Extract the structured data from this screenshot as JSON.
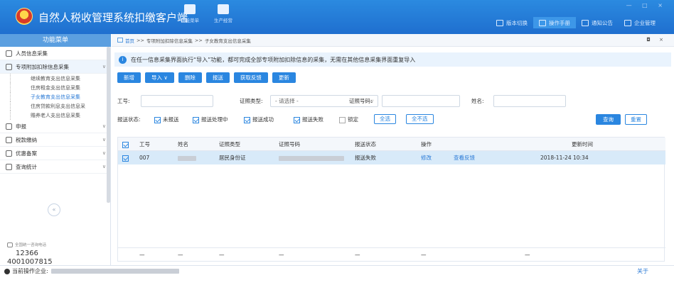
{
  "app": {
    "title": "自然人税收管理系统扣缴客户端",
    "window_controls": "— □ ×"
  },
  "topnav": [
    {
      "label": "功能菜单",
      "icon": "menu-icon"
    },
    {
      "label": "生产经营",
      "icon": "briefcase-icon"
    }
  ],
  "toplinks": [
    {
      "label": "版本切换",
      "icon": "version-icon",
      "active": false
    },
    {
      "label": "操作手册",
      "icon": "manual-icon",
      "active": true
    },
    {
      "label": "通知公告",
      "icon": "mail-icon",
      "active": false
    },
    {
      "label": "企业管理",
      "icon": "company-icon",
      "active": false
    }
  ],
  "sidebar": {
    "header": "功能菜单",
    "items": [
      {
        "label": "人员信息采集",
        "icon": "person-icon"
      },
      {
        "label": "专项附加扣除信息采集",
        "icon": "list-icon",
        "open": true
      }
    ],
    "sub_items": [
      {
        "label": "继续教育支出信息采集",
        "active": false
      },
      {
        "label": "住房租金支出信息采集",
        "active": false
      },
      {
        "label": "子女教育支出信息采集",
        "active": true
      },
      {
        "label": "住房贷款利息支出信息采",
        "active": false
      },
      {
        "label": "赡养老人支出信息采集",
        "active": false
      }
    ],
    "items_after": [
      {
        "label": "申报",
        "icon": "grid-icon"
      },
      {
        "label": "税款缴纳",
        "icon": "grid-icon"
      },
      {
        "label": "优惠备案",
        "icon": "doc-icon"
      },
      {
        "label": "查询统计",
        "icon": "grid-icon"
      }
    ],
    "collapse": "«",
    "hotline_label": "全国统一咨询电话",
    "hotline_1": "12366",
    "hotline_2": "4001007815"
  },
  "breadcrumb": {
    "home": "首页",
    "sep": ">>",
    "level1": "专项附加扣除信息采集",
    "level2": "子女教育支出信息采集",
    "controls": "◘ ×"
  },
  "notice": "在任一信息采集界面执行“导入”功能，都可完成全部专项附加扣除信息的采集，无需在其他信息采集界面重复导入",
  "toolbar": {
    "add": "新增",
    "import": "导入 ∨",
    "delete": "删除",
    "submit": "报送",
    "feedback": "获取反馈",
    "update": "更新"
  },
  "search": {
    "emp_no_label": "工号:",
    "emp_no_value": "",
    "id_type_label": "证照类型:",
    "id_type_value": "- 请选择 -",
    "id_no_label": "证照号码:",
    "id_no_value": "",
    "name_label": "姓名:",
    "name_value": "",
    "status_label": "报送状态:",
    "statuses": [
      {
        "label": "未报送",
        "checked": true
      },
      {
        "label": "报送处理中",
        "checked": true
      },
      {
        "label": "报送成功",
        "checked": true
      },
      {
        "label": "报送失败",
        "checked": true
      },
      {
        "label": "锁定",
        "checked": false
      }
    ],
    "select_all": "全选",
    "select_none": "全不选",
    "query": "查询",
    "reset": "重置"
  },
  "table": {
    "headers": [
      "工号",
      "姓名",
      "证照类型",
      "证照号码",
      "报送状态",
      "操作",
      "更新时间"
    ],
    "rows": [
      {
        "emp_no": "007",
        "name": "",
        "id_type": "居民身份证",
        "id_no": "",
        "status": "报送失败",
        "edit": "修改",
        "view_feedback": "查看反馈",
        "updated": "2018-11-24 10:34"
      }
    ],
    "footer": [
      "—",
      "—",
      "—",
      "—",
      "—",
      "—",
      "—"
    ]
  },
  "statusbar": {
    "label": "当前操作企业:",
    "about": "关于"
  }
}
